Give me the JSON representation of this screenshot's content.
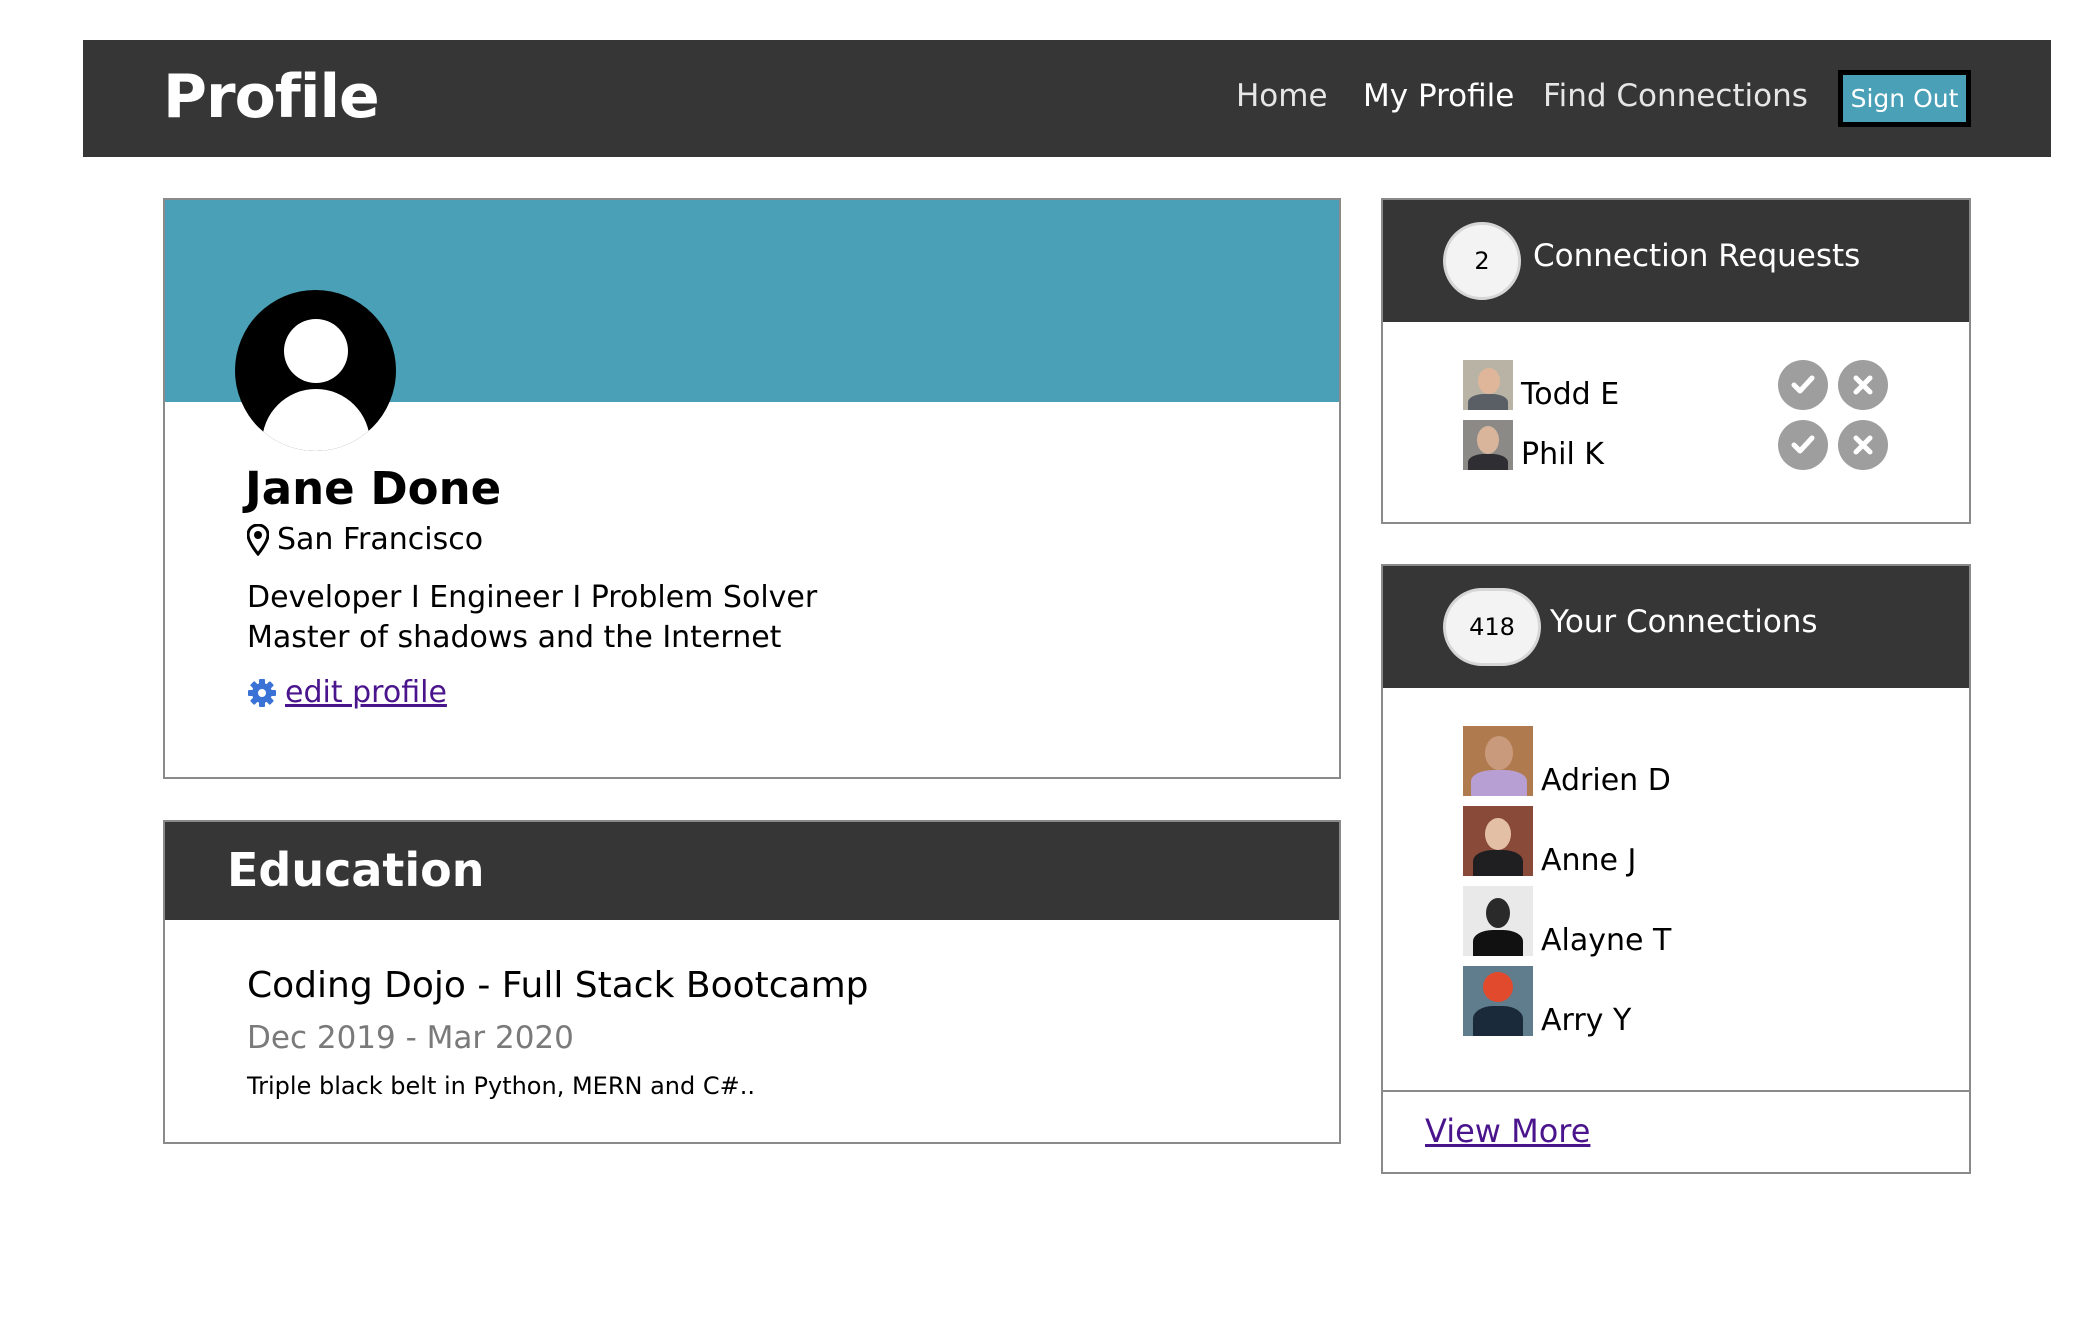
{
  "navbar": {
    "brand": "Profile",
    "links": [
      "Home",
      "My Profile",
      "Find Connections"
    ],
    "signout_label": "Sign Out"
  },
  "profile": {
    "name": "Jane Done",
    "location": "San Francisco",
    "bio_line1": "Developer I Engineer I Problem Solver",
    "bio_line2": "Master of shadows and the Internet",
    "edit_label": "edit profile"
  },
  "education": {
    "heading": "Education",
    "title": "Coding Dojo - Full Stack Bootcamp",
    "dates": "Dec 2019 - Mar 2020",
    "description": "Triple black belt in Python, MERN and C#.."
  },
  "requests": {
    "count": "2",
    "heading": "Connection Requests",
    "people": [
      "Todd E",
      "Phil K"
    ]
  },
  "connections": {
    "count": "418",
    "heading": "Your Connections",
    "people": [
      "Adrien D",
      "Anne J",
      "Alayne T",
      "Arry Y"
    ],
    "view_more_label": "View More"
  },
  "colors": {
    "navbar": "#363636",
    "accent": "#4aa0b7",
    "link": "#4a148c",
    "action": "#9e9e9e"
  }
}
